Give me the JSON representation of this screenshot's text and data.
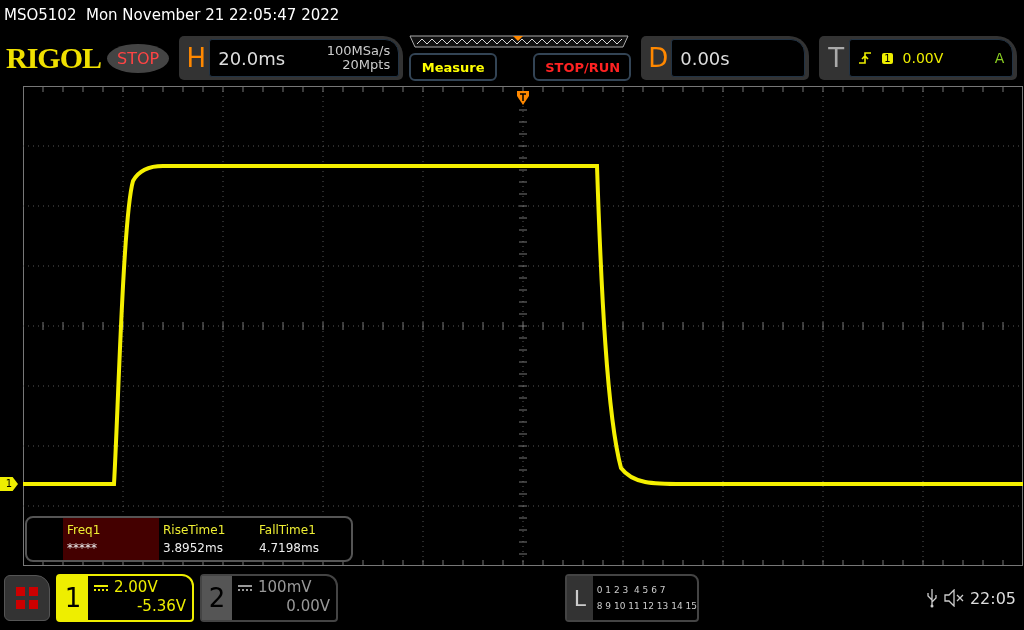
{
  "title_bar": {
    "text": "MSO5102  Mon November 21 22:05:47 2022"
  },
  "header": {
    "logo": "RIGOL",
    "run_status": "STOP",
    "horizontal": {
      "label": "H",
      "timebase": "20.0ms",
      "sample_rate": "100MSa/s",
      "memory_depth": "20Mpts"
    },
    "buttons": [
      {
        "label": "Measure",
        "kind": "menu"
      },
      {
        "label": "STOP/RUN",
        "kind": "run"
      }
    ],
    "delay": {
      "label": "D",
      "value": "0.00s"
    },
    "trigger": {
      "label": "T",
      "source": "1",
      "level": "0.00V",
      "mode": "A"
    }
  },
  "channel_marker": "1",
  "measurements": [
    {
      "label": "Freq1",
      "value": "*****",
      "selected": true
    },
    {
      "label": "RiseTime1",
      "value": "3.8952ms",
      "selected": false
    },
    {
      "label": "FallTime1",
      "value": "4.7198ms",
      "selected": false
    }
  ],
  "channels": [
    {
      "number": "1",
      "scale": "2.00V",
      "offset": "-5.36V",
      "active": true
    },
    {
      "number": "2",
      "scale": "100mV",
      "offset": "0.00V",
      "active": false
    }
  ],
  "logic": {
    "label": "L",
    "rows": [
      "0 1 2 3  4 5 6 7",
      "8 9 10 11 12 13 14 15"
    ]
  },
  "status": {
    "time": "22:05"
  }
}
